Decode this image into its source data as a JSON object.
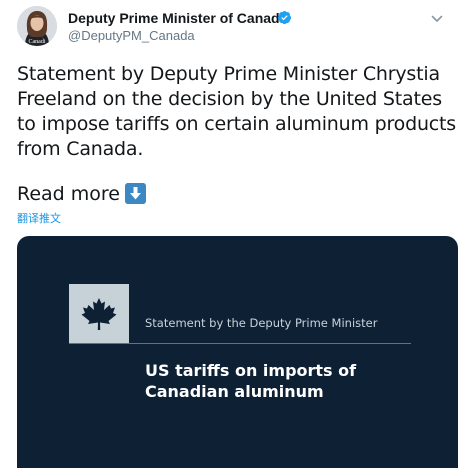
{
  "account": {
    "display_name": "Deputy Prime Minister of Canada",
    "handle": "@DeputyPM_Canada",
    "avatar_caption": "Canadi"
  },
  "tweet": {
    "text": "Statement by Deputy Prime Minister Chrystia Freeland on the decision by the United States to impose tariffs on certain aluminum products from Canada.",
    "read_more": "Read more",
    "translate": "翻译推文"
  },
  "card": {
    "kicker": "Statement by the Deputy Prime Minister",
    "headline_line1": "US tariffs on imports of",
    "headline_line2": "Canadian aluminum"
  },
  "colors": {
    "verified": "#1da1f2",
    "card_background": "#0d2034",
    "link": "#1b95e0",
    "arrow_emoji": "#3b88c3"
  },
  "icons": [
    "verified-badge-icon",
    "chevron-down-icon",
    "down-arrow-icon",
    "maple-leaf-icon"
  ]
}
